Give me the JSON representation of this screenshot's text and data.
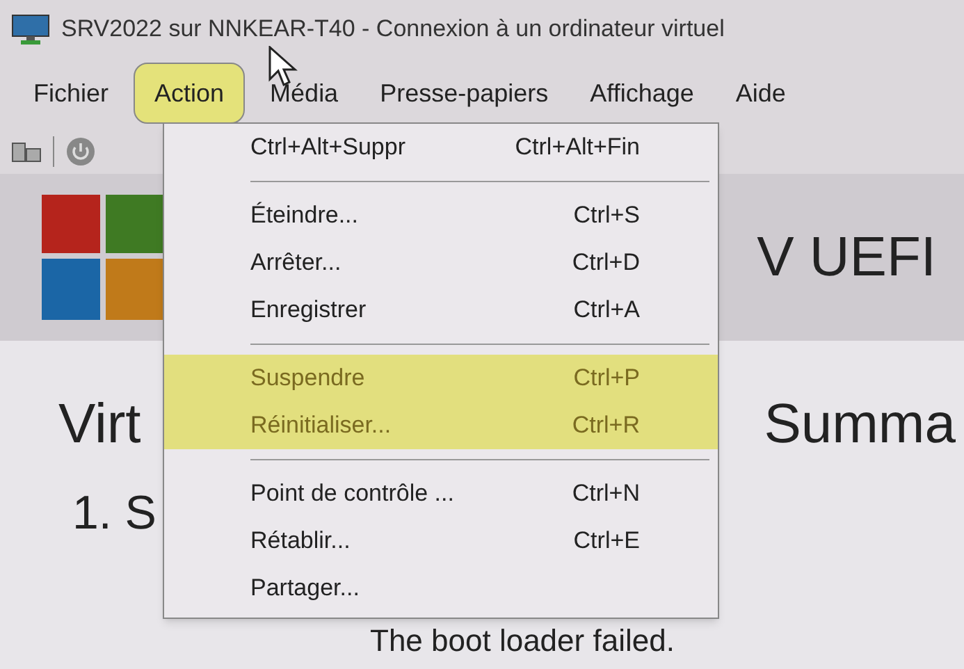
{
  "window": {
    "title": "SRV2022 sur NNKEAR-T40 - Connexion à un ordinateur virtuel"
  },
  "menu_bar": [
    {
      "label": "Fichier",
      "selected": false
    },
    {
      "label": "Action",
      "selected": true
    },
    {
      "label": "Média",
      "selected": false
    },
    {
      "label": "Presse-papiers",
      "selected": false
    },
    {
      "label": "Affichage",
      "selected": false
    },
    {
      "label": "Aide",
      "selected": false
    }
  ],
  "dropdown": [
    {
      "kind": "item",
      "label": "Ctrl+Alt+Suppr",
      "shortcut": "Ctrl+Alt+Fin",
      "highlighted": false
    },
    {
      "kind": "separator"
    },
    {
      "kind": "item",
      "label": "Éteindre...",
      "shortcut": "Ctrl+S",
      "highlighted": false
    },
    {
      "kind": "item",
      "label": "Arrêter...",
      "shortcut": "Ctrl+D",
      "highlighted": false
    },
    {
      "kind": "item",
      "label": "Enregistrer",
      "shortcut": "Ctrl+A",
      "highlighted": false
    },
    {
      "kind": "separator"
    },
    {
      "kind": "item",
      "label": "Suspendre",
      "shortcut": "Ctrl+P",
      "highlighted": true
    },
    {
      "kind": "item",
      "label": "Réinitialiser...",
      "shortcut": "Ctrl+R",
      "highlighted": true
    },
    {
      "kind": "separator"
    },
    {
      "kind": "item",
      "label": "Point de contrôle ...",
      "shortcut": "Ctrl+N",
      "highlighted": false
    },
    {
      "kind": "item",
      "label": "Rétablir...",
      "shortcut": "Ctrl+E",
      "highlighted": false
    },
    {
      "kind": "item",
      "label": "Partager...",
      "highlighted": false
    }
  ],
  "vm_screen": {
    "header_title": "V UEFI",
    "heading_left": "Virt",
    "heading_right": "Summa",
    "list_item": "1. S",
    "message": "The boot loader failed."
  }
}
